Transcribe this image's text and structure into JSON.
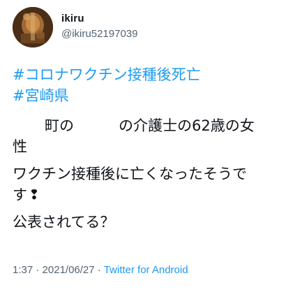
{
  "user": {
    "display_name": "ikiru",
    "handle": "@ikiru52197039",
    "avatar_icon": "avatar-photo-icon"
  },
  "tweet": {
    "hashtags": [
      "#コロナワクチン接種後死亡",
      "#宮崎県"
    ],
    "line1_part1": "町の",
    "line1_part2": "の介護士の62歳の女",
    "line2": "性",
    "line3": "ワクチン接種後に亡くなったそうで",
    "line4": "す",
    "line4_icon": "double-exclamation-icon",
    "line4_glyph": "❢",
    "line5": "公表されてる？"
  },
  "meta": {
    "time": "1:37",
    "separator1": " · ",
    "date": "2021/06/27",
    "separator2": " · ",
    "source": "Twitter for Android"
  },
  "colors": {
    "link": "#1d9bf0",
    "text": "#0f1419",
    "secondary": "#536471"
  }
}
